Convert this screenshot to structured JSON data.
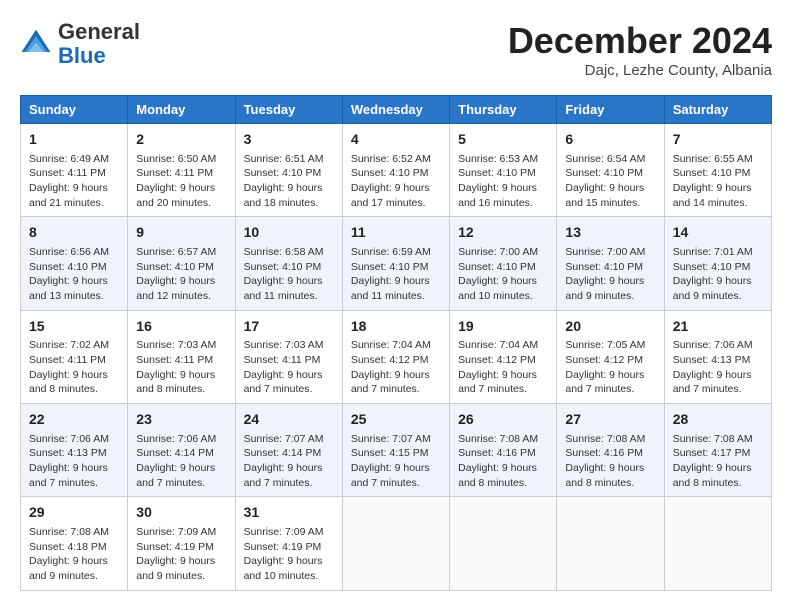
{
  "header": {
    "logo": {
      "general": "General",
      "blue": "Blue"
    },
    "month": "December 2024",
    "location": "Dajc, Lezhe County, Albania"
  },
  "weekdays": [
    "Sunday",
    "Monday",
    "Tuesday",
    "Wednesday",
    "Thursday",
    "Friday",
    "Saturday"
  ],
  "weeks": [
    [
      {
        "day": "1",
        "info": "Sunrise: 6:49 AM\nSunset: 4:11 PM\nDaylight: 9 hours and 21 minutes."
      },
      {
        "day": "2",
        "info": "Sunrise: 6:50 AM\nSunset: 4:11 PM\nDaylight: 9 hours and 20 minutes."
      },
      {
        "day": "3",
        "info": "Sunrise: 6:51 AM\nSunset: 4:10 PM\nDaylight: 9 hours and 18 minutes."
      },
      {
        "day": "4",
        "info": "Sunrise: 6:52 AM\nSunset: 4:10 PM\nDaylight: 9 hours and 17 minutes."
      },
      {
        "day": "5",
        "info": "Sunrise: 6:53 AM\nSunset: 4:10 PM\nDaylight: 9 hours and 16 minutes."
      },
      {
        "day": "6",
        "info": "Sunrise: 6:54 AM\nSunset: 4:10 PM\nDaylight: 9 hours and 15 minutes."
      },
      {
        "day": "7",
        "info": "Sunrise: 6:55 AM\nSunset: 4:10 PM\nDaylight: 9 hours and 14 minutes."
      }
    ],
    [
      {
        "day": "8",
        "info": "Sunrise: 6:56 AM\nSunset: 4:10 PM\nDaylight: 9 hours and 13 minutes."
      },
      {
        "day": "9",
        "info": "Sunrise: 6:57 AM\nSunset: 4:10 PM\nDaylight: 9 hours and 12 minutes."
      },
      {
        "day": "10",
        "info": "Sunrise: 6:58 AM\nSunset: 4:10 PM\nDaylight: 9 hours and 11 minutes."
      },
      {
        "day": "11",
        "info": "Sunrise: 6:59 AM\nSunset: 4:10 PM\nDaylight: 9 hours and 11 minutes."
      },
      {
        "day": "12",
        "info": "Sunrise: 7:00 AM\nSunset: 4:10 PM\nDaylight: 9 hours and 10 minutes."
      },
      {
        "day": "13",
        "info": "Sunrise: 7:00 AM\nSunset: 4:10 PM\nDaylight: 9 hours and 9 minutes."
      },
      {
        "day": "14",
        "info": "Sunrise: 7:01 AM\nSunset: 4:10 PM\nDaylight: 9 hours and 9 minutes."
      }
    ],
    [
      {
        "day": "15",
        "info": "Sunrise: 7:02 AM\nSunset: 4:11 PM\nDaylight: 9 hours and 8 minutes."
      },
      {
        "day": "16",
        "info": "Sunrise: 7:03 AM\nSunset: 4:11 PM\nDaylight: 9 hours and 8 minutes."
      },
      {
        "day": "17",
        "info": "Sunrise: 7:03 AM\nSunset: 4:11 PM\nDaylight: 9 hours and 7 minutes."
      },
      {
        "day": "18",
        "info": "Sunrise: 7:04 AM\nSunset: 4:12 PM\nDaylight: 9 hours and 7 minutes."
      },
      {
        "day": "19",
        "info": "Sunrise: 7:04 AM\nSunset: 4:12 PM\nDaylight: 9 hours and 7 minutes."
      },
      {
        "day": "20",
        "info": "Sunrise: 7:05 AM\nSunset: 4:12 PM\nDaylight: 9 hours and 7 minutes."
      },
      {
        "day": "21",
        "info": "Sunrise: 7:06 AM\nSunset: 4:13 PM\nDaylight: 9 hours and 7 minutes."
      }
    ],
    [
      {
        "day": "22",
        "info": "Sunrise: 7:06 AM\nSunset: 4:13 PM\nDaylight: 9 hours and 7 minutes."
      },
      {
        "day": "23",
        "info": "Sunrise: 7:06 AM\nSunset: 4:14 PM\nDaylight: 9 hours and 7 minutes."
      },
      {
        "day": "24",
        "info": "Sunrise: 7:07 AM\nSunset: 4:14 PM\nDaylight: 9 hours and 7 minutes."
      },
      {
        "day": "25",
        "info": "Sunrise: 7:07 AM\nSunset: 4:15 PM\nDaylight: 9 hours and 7 minutes."
      },
      {
        "day": "26",
        "info": "Sunrise: 7:08 AM\nSunset: 4:16 PM\nDaylight: 9 hours and 8 minutes."
      },
      {
        "day": "27",
        "info": "Sunrise: 7:08 AM\nSunset: 4:16 PM\nDaylight: 9 hours and 8 minutes."
      },
      {
        "day": "28",
        "info": "Sunrise: 7:08 AM\nSunset: 4:17 PM\nDaylight: 9 hours and 8 minutes."
      }
    ],
    [
      {
        "day": "29",
        "info": "Sunrise: 7:08 AM\nSunset: 4:18 PM\nDaylight: 9 hours and 9 minutes."
      },
      {
        "day": "30",
        "info": "Sunrise: 7:09 AM\nSunset: 4:19 PM\nDaylight: 9 hours and 9 minutes."
      },
      {
        "day": "31",
        "info": "Sunrise: 7:09 AM\nSunset: 4:19 PM\nDaylight: 9 hours and 10 minutes."
      },
      null,
      null,
      null,
      null
    ]
  ]
}
